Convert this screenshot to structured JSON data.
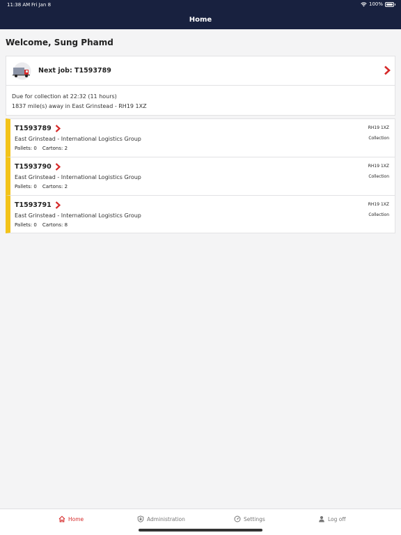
{
  "status_bar": {
    "time": "11:38 AM",
    "date": "Fri Jan 8",
    "battery": "100%"
  },
  "navbar": {
    "title": "Home"
  },
  "welcome": "Welcome, Sung Phamd",
  "next_job": {
    "label": "Next job: T1593789",
    "due_line": "Due for collection at 22:32 (11 hours)",
    "distance_line": "1837 mile(s) away in East Grinstead - RH19 1XZ"
  },
  "jobs": [
    {
      "id": "T1593789",
      "company": "East Grinstead - International Logistics Group",
      "pallets": "Pallets: 0",
      "cartons": "Cartons: 2",
      "postcode": "RH19 1XZ",
      "type": "Collection"
    },
    {
      "id": "T1593790",
      "company": "East Grinstead - International Logistics Group",
      "pallets": "Pallets: 0",
      "cartons": "Cartons: 2",
      "postcode": "RH19 1XZ",
      "type": "Collection"
    },
    {
      "id": "T1593791",
      "company": "East Grinstead - International Logistics Group",
      "pallets": "Pallets: 0",
      "cartons": "Cartons: 8",
      "postcode": "RH19 1XZ",
      "type": "Collection"
    }
  ],
  "tabs": [
    {
      "label": "Home",
      "icon": "home-icon",
      "active": true
    },
    {
      "label": "Administration",
      "icon": "shield-icon",
      "active": false
    },
    {
      "label": "Settings",
      "icon": "gauge-icon",
      "active": false
    },
    {
      "label": "Log off",
      "icon": "person-icon",
      "active": false
    }
  ],
  "colors": {
    "header_bg": "#18213f",
    "accent_red": "#d62a2a",
    "job_stripe": "#f3c319"
  }
}
